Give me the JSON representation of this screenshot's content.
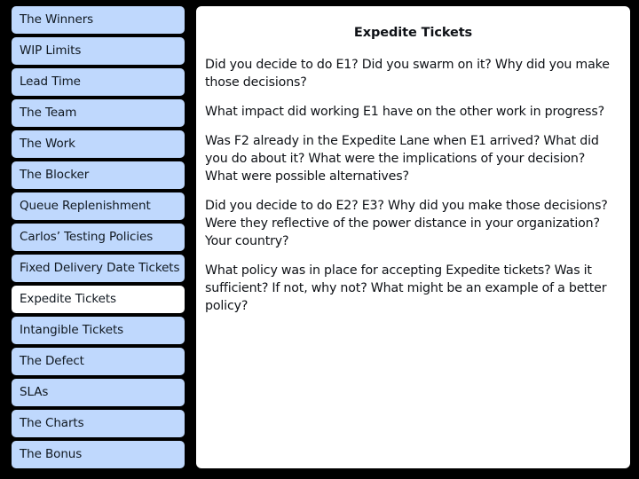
{
  "slide": {
    "background_color": "#000000",
    "panel_background": "#FFFFFF",
    "nav_item_color": "#BFD8FD",
    "nav_item_active_color": "#FFFFFF",
    "text_color": "#0E1116"
  },
  "sidebar": {
    "items": [
      {
        "label": "The Winners",
        "active": false
      },
      {
        "label": "WIP Limits",
        "active": false
      },
      {
        "label": "Lead Time",
        "active": false
      },
      {
        "label": "The Team",
        "active": false
      },
      {
        "label": "The Work",
        "active": false
      },
      {
        "label": "The Blocker",
        "active": false
      },
      {
        "label": "Queue Replenishment",
        "active": false
      },
      {
        "label": "Carlos’ Testing Policies",
        "active": false
      },
      {
        "label": "Fixed Delivery Date Tickets",
        "active": false
      },
      {
        "label": "Expedite Tickets",
        "active": true
      },
      {
        "label": "Intangible Tickets",
        "active": false
      },
      {
        "label": "The Defect",
        "active": false
      },
      {
        "label": "SLAs",
        "active": false
      },
      {
        "label": "The Charts",
        "active": false
      },
      {
        "label": "The Bonus",
        "active": false
      }
    ]
  },
  "content": {
    "title": "Expedite Tickets",
    "paragraphs": [
      "Did you decide to do E1? Did you swarm on it? Why did you make those decisions?",
      "What impact did working E1 have on the other work in progress?",
      "Was F2 already in the Expedite Lane when E1 arrived? What did you do about it? What were the implications of your decision? What were possible alternatives?",
      "Did you decide to do E2? E3? Why did you make those decisions? Were they reflective of the power distance in your organization? Your country?",
      "What policy was in place for accepting Expedite tickets? Was it sufficient? If not, why not? What might be an example of a better policy?"
    ]
  }
}
